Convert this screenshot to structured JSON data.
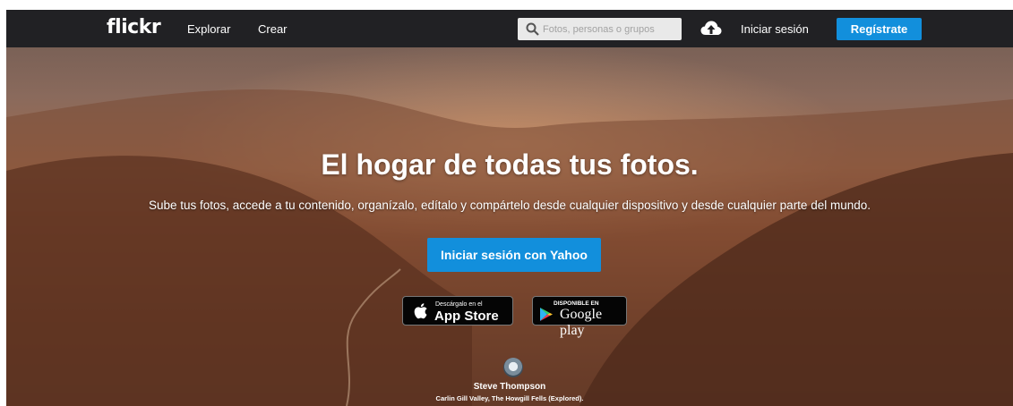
{
  "header": {
    "logo": "flickr",
    "nav": {
      "explore": "Explorar",
      "create": "Crear"
    },
    "search_placeholder": "Fotos, personas o grupos",
    "upload_icon": "cloud-upload-icon",
    "signin_label": "Iniciar sesión",
    "register_label": "Regístrate"
  },
  "hero": {
    "title": "El hogar de todas tus fotos.",
    "subtitle": "Sube tus fotos, accede a tu contenido, organízalo, edítalo y compártelo desde cualquier dispositivo y desde cualquier parte del mundo.",
    "cta_label": "Iniciar sesión con Yahoo",
    "app_store": {
      "small": "Descárgalo en el",
      "big": "App Store"
    },
    "google_play": {
      "small": "DISPONIBLE EN",
      "big": "Google play"
    }
  },
  "photo_credit": {
    "author": "Steve Thompson",
    "title": "Carlin Gill Valley, The Howgill Fells (Explored)."
  },
  "colors": {
    "nav_bg": "#212124",
    "accent": "#128fdc"
  }
}
